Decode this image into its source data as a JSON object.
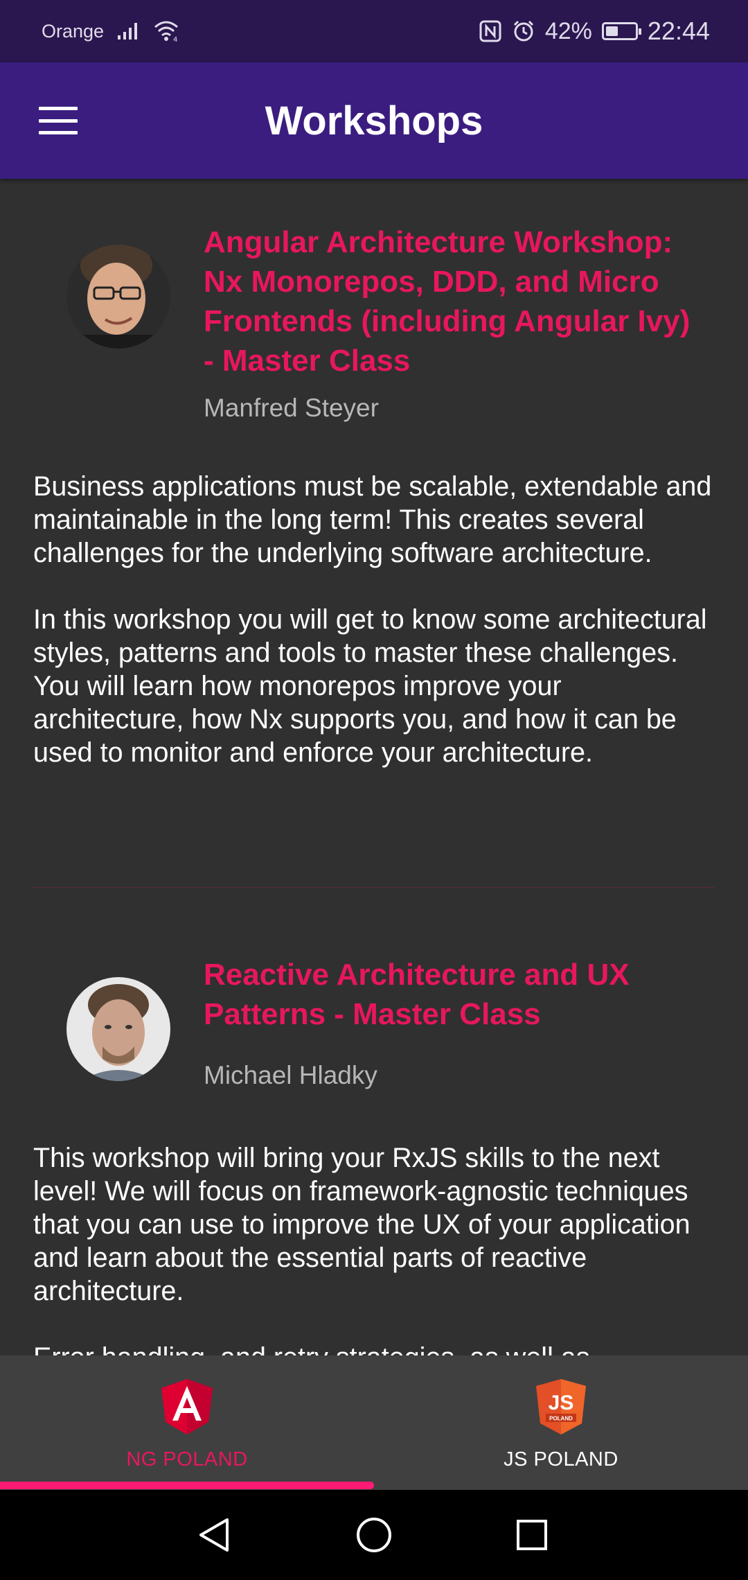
{
  "status_bar": {
    "carrier": "Orange",
    "battery": "42%",
    "battery_level": 0.42,
    "time": "22:44"
  },
  "app_bar": {
    "title": "Workshops",
    "menu_icon": "menu-icon"
  },
  "workshops": [
    {
      "title": "Angular Architecture Workshop: Nx Monorepos, DDD, and Micro Frontends (including Angular Ivy) - Master Class",
      "speaker": "Manfred Steyer",
      "description": [
        "Business applications must be scalable, extendable and maintainable in the long term! This creates several challenges for the underlying software architecture.",
        "In this workshop you will get to know some architectural styles, patterns and tools to master these challenges. You will learn how monorepos improve your architecture, how Nx supports you, and how it can be used to monitor and enforce your architecture."
      ]
    },
    {
      "title": "Reactive Architecture and UX Patterns - Master Class",
      "speaker": "Michael Hladky",
      "description": [
        "This workshop will bring your RxJS skills to the next level! We will focus on framework-agnostic techniques that you can use to improve the UX of your application and learn about the essential parts of reactive architecture.",
        "Error handling, and retry strategies, as well as"
      ]
    }
  ],
  "bottom_nav": {
    "tabs": [
      {
        "label": "NG POLAND",
        "icon": "angular-shield-icon",
        "active": true
      },
      {
        "label": "JS POLAND",
        "icon": "js-shield-icon",
        "active": false
      }
    ]
  },
  "colors": {
    "accent": "#e8175d",
    "app_bar": "#3b1d80",
    "status_bar": "#2a174f",
    "background": "#303030",
    "bottom_nav": "#404040"
  }
}
